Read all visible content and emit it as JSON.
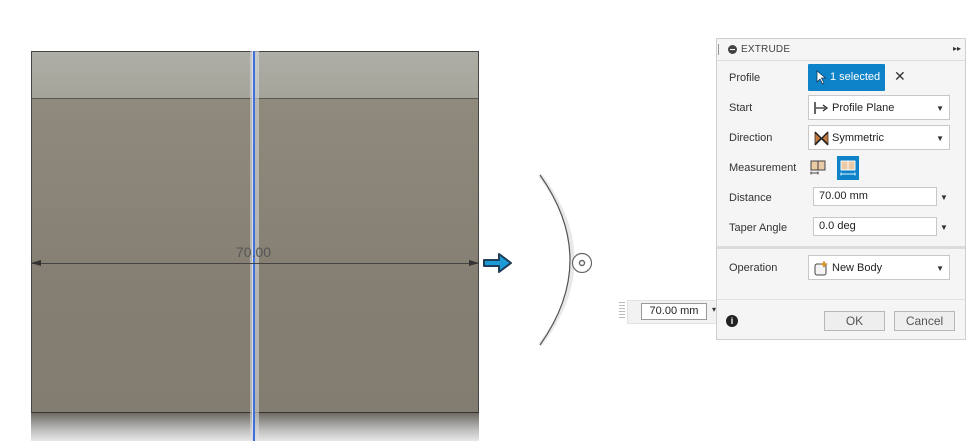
{
  "viewport": {
    "dimension_label": "70.00",
    "dimension_input": "70.00 mm"
  },
  "panel": {
    "title": "EXTRUDE",
    "rows": {
      "profile": {
        "label": "Profile",
        "selection": "1 selected"
      },
      "start": {
        "label": "Start",
        "value": "Profile Plane"
      },
      "direction": {
        "label": "Direction",
        "value": "Symmetric"
      },
      "measurement": {
        "label": "Measurement",
        "selected": 2
      },
      "distance": {
        "label": "Distance",
        "value": "70.00 mm"
      },
      "taper": {
        "label": "Taper Angle",
        "value": "0.0 deg"
      },
      "operation": {
        "label": "Operation",
        "value": "New Body"
      }
    },
    "buttons": {
      "ok": "OK",
      "cancel": "Cancel"
    }
  },
  "colors": {
    "accent": "#0e83c9",
    "plane_line": "#3f6fd8",
    "body_face": "#8a8577"
  },
  "icons": [
    "cursor-icon",
    "close-icon",
    "profile-plane-icon",
    "symmetric-icon",
    "measure-one-side-icon",
    "measure-whole-icon",
    "new-body-icon",
    "info-icon",
    "expand-icon",
    "dropdown-caret-icon"
  ]
}
